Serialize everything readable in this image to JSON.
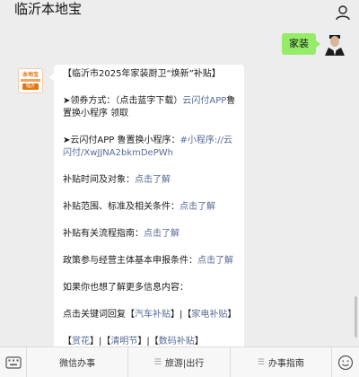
{
  "header": {
    "title": "临沂本地宝"
  },
  "user_message": {
    "text": "家装"
  },
  "bot": {
    "avatar_brand": "本地宝",
    "avatar_city": "临沂"
  },
  "reply": {
    "p1": "【临沂市2025年家装厨卫“焕新”补贴】",
    "p2": {
      "prefix": "➤领券方式：（点击蓝字下载）",
      "link": "云闪付APP",
      "suffix": "鲁置换小程序 领取"
    },
    "p3": {
      "prefix": "➤云闪付APP 鲁置换小程序：",
      "link": "#小程序://云闪付/XwJJNA2bkmDePWh"
    },
    "p4": {
      "prefix": "补贴时间及对象：",
      "link": "点击了解"
    },
    "p5": {
      "prefix": "补贴范围、标准及相关条件：",
      "link": "点击了解"
    },
    "p6": {
      "prefix": "补贴有关流程指南：",
      "link": "点击了解"
    },
    "p7": {
      "prefix": "政策参与经营主体基本申报条件：",
      "link": "点击了解"
    },
    "p8": "如果你也想了解更多信息内容：",
    "p9": {
      "prefix": "点击关键词回复【",
      "link1": "汽车补贴",
      "mid": "】|【",
      "link2": "家电补贴",
      "suffix": "】"
    },
    "p10": {
      "b1": "【",
      "link1": "赏花",
      "s1": "】|【",
      "link2": "清明节",
      "s2": "】|【",
      "link3": "数码补贴",
      "s3": "】"
    }
  },
  "bottom_menu": {
    "item1": "微信办事",
    "item2": "旅游|出行",
    "item3": "办事指南"
  },
  "colors": {
    "link": "#576b95",
    "user_bubble": "#95ec69",
    "background": "#ededed"
  },
  "icons": {
    "user": "user-icon",
    "keyboard": "keyboard-icon",
    "emoji": "smiley-icon",
    "menu": "menu-bars-icon"
  }
}
